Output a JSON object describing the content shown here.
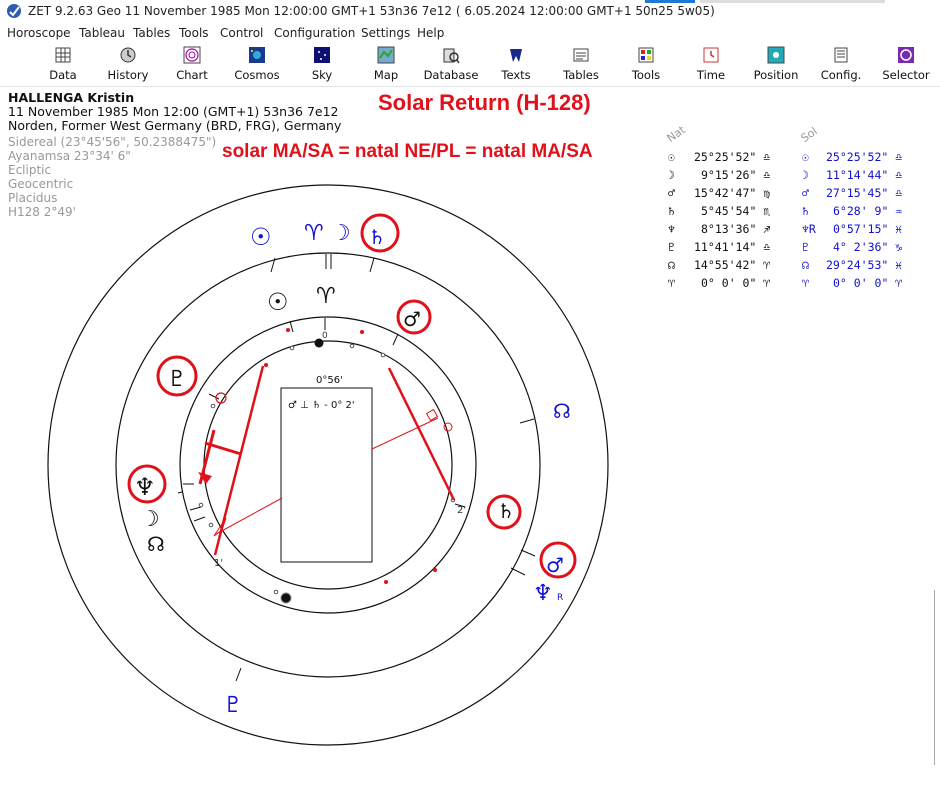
{
  "titlebar": {
    "text": "ZET 9.2.63 Geo   11 November 1985  Mon  12:00:00 GMT+1 53n36  7e12  ( 6.05.2024  12:00:00 GMT+1 50n25 5w05)"
  },
  "menu": [
    "Horoscope",
    "Tableau",
    "Tables",
    "Tools",
    "Control",
    "Configuration",
    "Settings",
    "Help"
  ],
  "toolbar": [
    "Data",
    "History",
    "Chart",
    "Cosmos",
    "Sky",
    "Map",
    "Database",
    "Texts",
    "Tables",
    "Tools",
    "Time",
    "Position",
    "Config.",
    "Selector"
  ],
  "person": {
    "name": "HALLENGA Kristin",
    "datetime": "11 November 1985  Mon  12:00 (GMT+1) 53n36  7e12",
    "place": "Norden, Former West Germany (BRD, FRG), Germany"
  },
  "settings": [
    "Sidereal (23°45'56\", 50.2388475\")",
    "Ayanamsa 23°34' 6\"",
    "Ecliptic",
    "Geocentric",
    "Placidus",
    "H128   2°49'"
  ],
  "annotation": {
    "title": "Solar Return (H-128)",
    "subtitle": "solar MA/SA = natal NE/PL = natal MA/SA"
  },
  "chart": {
    "ascendant_degree_label": "0°56'",
    "aspect_note": "♂ ⊥ ♄  - 0° 2'",
    "axis_labels": [
      "0",
      "1'",
      "2'"
    ]
  },
  "positions_table": {
    "headers": [
      "Nat",
      "Sol"
    ],
    "rows": [
      {
        "glyph": "☉",
        "natal": "25°25'52\" ♎",
        "solar_glyph": "☉",
        "solar": "25°25'52\" ♎"
      },
      {
        "glyph": "☽",
        "natal": "9°15'26\" ♎",
        "solar_glyph": "☽",
        "solar": "11°14'44\" ♎"
      },
      {
        "glyph": "♂",
        "natal": "15°42'47\" ♍",
        "solar_glyph": "♂",
        "solar": "27°15'45\" ♎"
      },
      {
        "glyph": "♄",
        "natal": "5°45'54\" ♏",
        "solar_glyph": "♄",
        "solar": "6°28' 9\" ♒"
      },
      {
        "glyph": "♆",
        "natal": "8°13'36\" ♐",
        "solar_glyph": "♆R",
        "solar": "0°57'15\" ♓"
      },
      {
        "glyph": "♇",
        "natal": "11°41'14\" ♎",
        "solar_glyph": "♇",
        "solar": "4° 2'36\" ♑"
      },
      {
        "glyph": "☊",
        "natal": "14°55'42\" ♈",
        "solar_glyph": "☊",
        "solar": "29°24'53\" ♓"
      },
      {
        "glyph": "♈",
        "natal": "0° 0' 0\" ♈",
        "solar_glyph": "♈",
        "solar": "0° 0' 0\" ♈"
      }
    ]
  },
  "colors": {
    "accent_red": "#e0111a",
    "solar_blue": "#1010d0"
  }
}
